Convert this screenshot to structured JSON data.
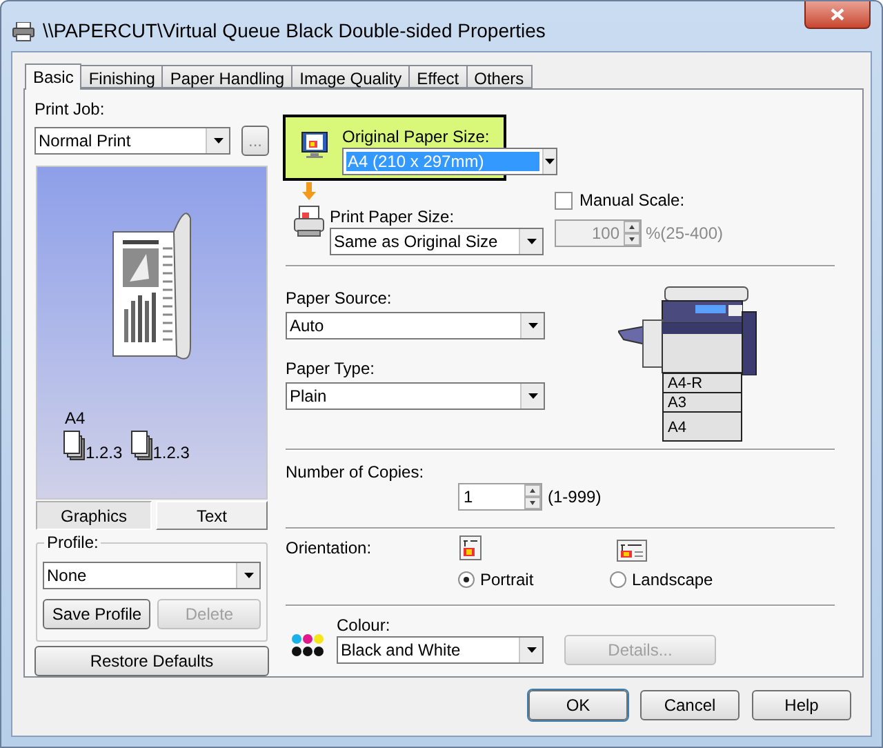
{
  "window": {
    "title": "\\\\PAPERCUT\\Virtual Queue Black Double-sided Properties"
  },
  "tabs": [
    {
      "label": "Basic",
      "selected": true
    },
    {
      "label": "Finishing",
      "selected": false
    },
    {
      "label": "Paper Handling",
      "selected": false
    },
    {
      "label": "Image Quality",
      "selected": false
    },
    {
      "label": "Effect",
      "selected": false
    },
    {
      "label": "Others",
      "selected": false
    }
  ],
  "print_job": {
    "label": "Print Job:",
    "value": "Normal Print",
    "more_button": "..."
  },
  "preview": {
    "paper_label": "A4",
    "collate_labels": [
      "1.2.3",
      "1.2.3"
    ]
  },
  "preview_tabs": [
    {
      "label": "Graphics",
      "selected": true
    },
    {
      "label": "Text",
      "selected": false
    }
  ],
  "profile": {
    "label": "Profile:",
    "value": "None",
    "buttons": [
      {
        "label": "Save Profile",
        "disabled": false
      },
      {
        "label": "Delete",
        "disabled": true
      }
    ]
  },
  "restore_button": "Restore Defaults",
  "original_paper_size": {
    "label": "Original Paper Size:",
    "value": "A4 (210 x 297mm)",
    "highlighted": true
  },
  "print_paper_size": {
    "label": "Print Paper Size:",
    "value": "Same as Original Size"
  },
  "manual_scale": {
    "label": "Manual Scale:",
    "checked": false,
    "value": "100",
    "range": "%(25-400)",
    "disabled": true
  },
  "paper_source": {
    "label": "Paper Source:",
    "value": "Auto"
  },
  "paper_type": {
    "label": "Paper Type:",
    "value": "Plain"
  },
  "printer_trays": [
    "A4-R",
    "A3",
    "A4"
  ],
  "copies": {
    "label": "Number of Copies:",
    "value": "1",
    "range": "(1-999)"
  },
  "orientation": {
    "label": "Orientation:",
    "options": [
      {
        "label": "Portrait",
        "selected": true
      },
      {
        "label": "Landscape",
        "selected": false
      }
    ]
  },
  "colour": {
    "label": "Colour:",
    "value": "Black and White",
    "details_button": {
      "label": "Details...",
      "disabled": true
    }
  },
  "buttons": [
    {
      "label": "OK",
      "default": true
    },
    {
      "label": "Cancel",
      "default": false
    },
    {
      "label": "Help",
      "default": false
    }
  ]
}
